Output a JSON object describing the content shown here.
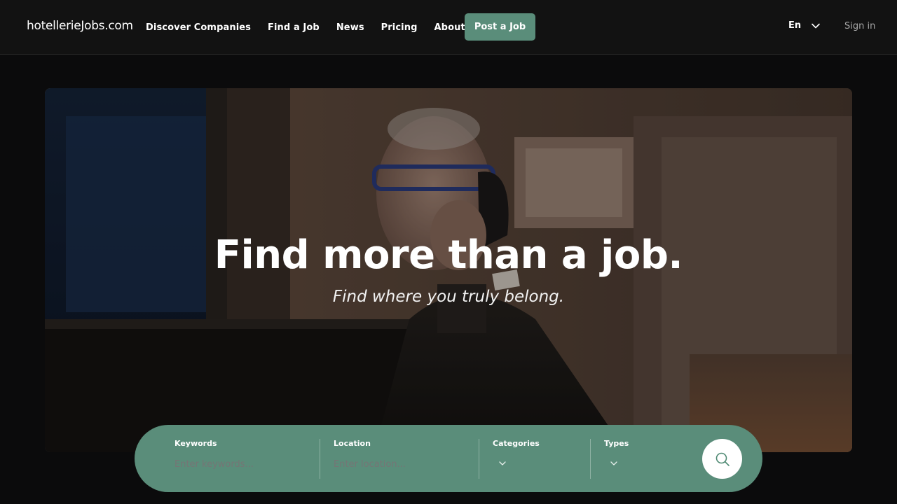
{
  "header": {
    "logo": "hotellerieJobs.com",
    "nav": [
      "Discover Companies",
      "Find a Job",
      "News",
      "Pricing",
      "About"
    ],
    "post_job_label": "Post a Job",
    "language": "En",
    "sign_in_label": "Sign in"
  },
  "hero": {
    "title": "Find more than a job.",
    "subtitle": "Find where you truly belong."
  },
  "search": {
    "keywords_label": "Keywords",
    "keywords_placeholder": "Enter keywords...",
    "location_label": "Location",
    "location_placeholder": "Enter location...",
    "categories_label": "Categories",
    "types_label": "Types"
  },
  "colors": {
    "accent": "#5a8d7a",
    "header_bg": "#121212",
    "page_bg": "#0b0b0c"
  },
  "icons": [
    "chevron-down-icon",
    "search-icon"
  ]
}
